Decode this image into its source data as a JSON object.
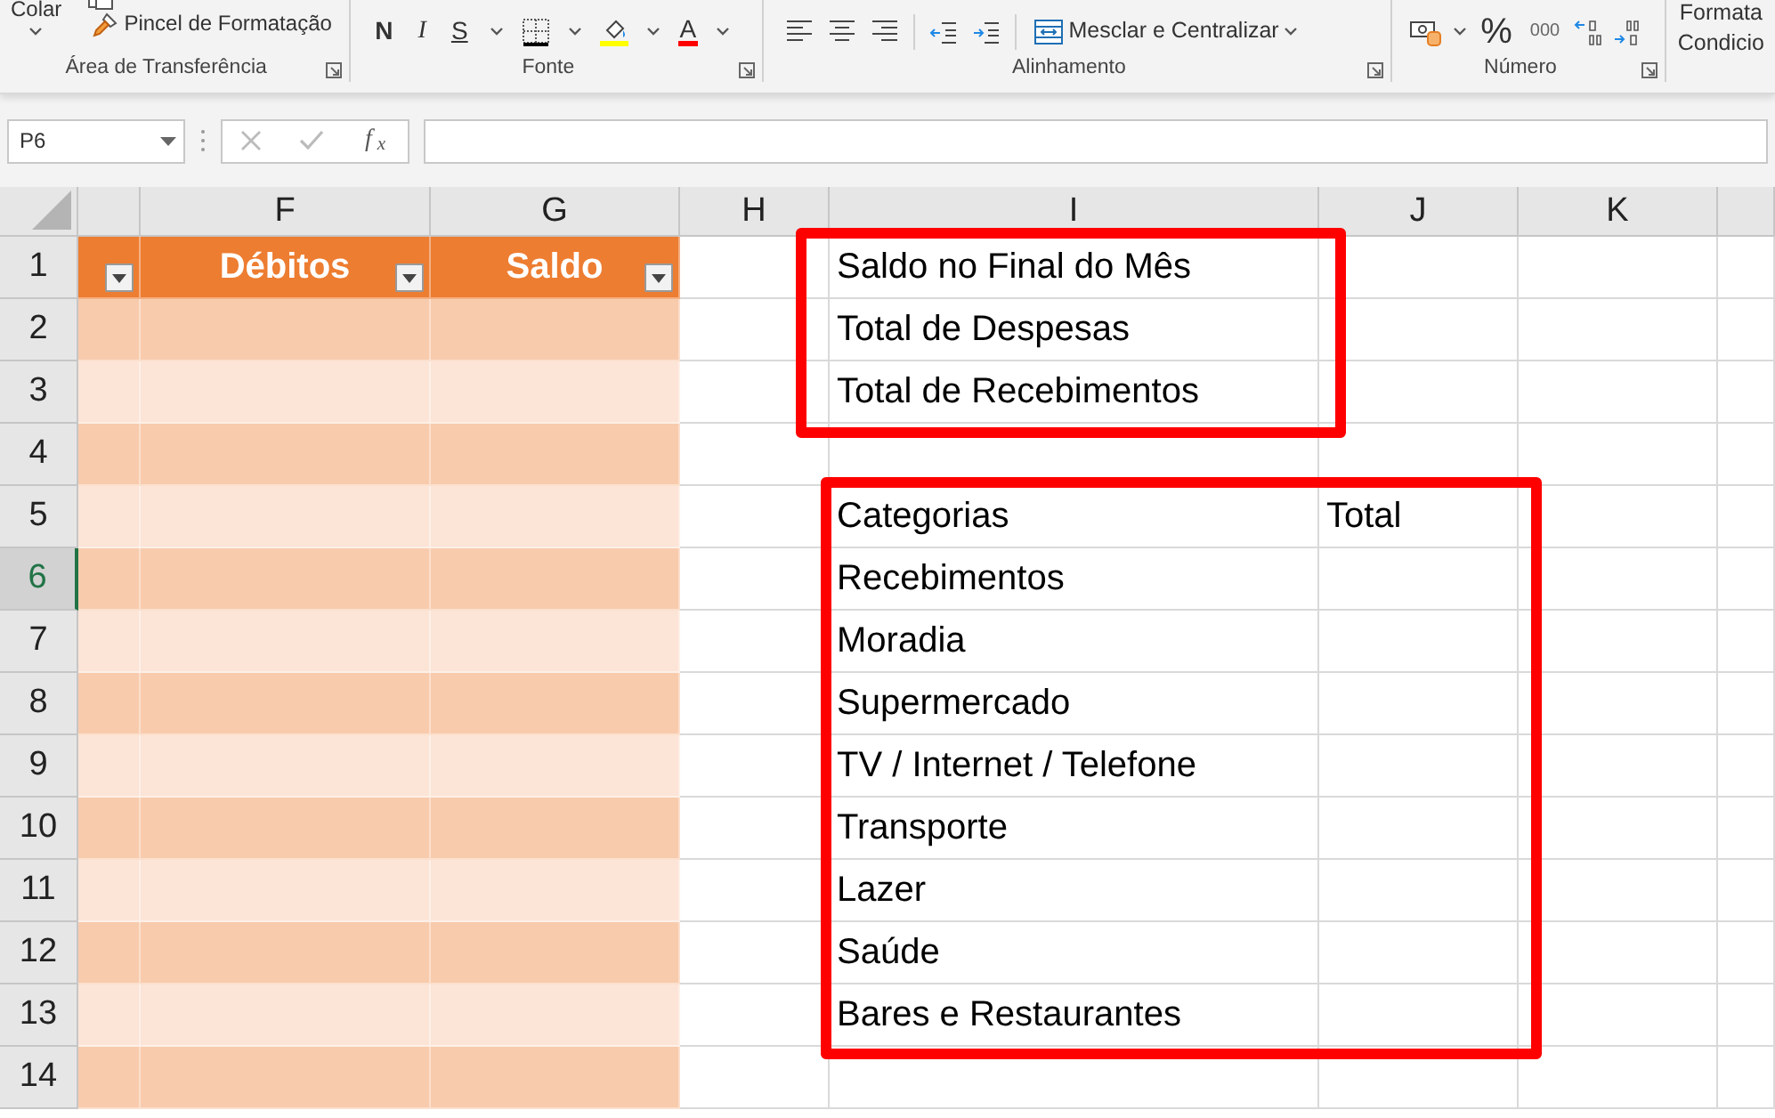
{
  "ribbon": {
    "clipboard": {
      "paste_label": "Colar",
      "format_painter_label": "Pincel de Formatação",
      "label": "Área de Transferência"
    },
    "font": {
      "label": "Fonte",
      "bold_label": "N",
      "italic_label": "I",
      "underline_label": "S",
      "font_color_letter": "A"
    },
    "alignment": {
      "label": "Alinhamento",
      "merge_label": "Mesclar e Centralizar"
    },
    "number": {
      "label": "Número",
      "percent_label": "%",
      "thousands_label": "000"
    },
    "styles": {
      "conditional_formatting_lines": [
        "Formata",
        "Condicio"
      ]
    }
  },
  "formula_bar": {
    "name_box": "P6",
    "function_label": "f$_{x}$"
  },
  "sheet": {
    "columns": [
      "F",
      "G",
      "H",
      "I",
      "J",
      "K"
    ],
    "rows": [
      {
        "label": "1",
        "selected": false
      },
      {
        "label": "2",
        "selected": false
      },
      {
        "label": "3",
        "selected": false
      },
      {
        "label": "4",
        "selected": false
      },
      {
        "label": "5",
        "selected": false
      },
      {
        "label": "6",
        "selected": true
      },
      {
        "label": "7",
        "selected": false
      },
      {
        "label": "8",
        "selected": false
      },
      {
        "label": "9",
        "selected": false
      },
      {
        "label": "10",
        "selected": false
      },
      {
        "label": "11",
        "selected": false
      },
      {
        "label": "12",
        "selected": false
      },
      {
        "label": "13",
        "selected": false
      },
      {
        "label": "14",
        "selected": false
      }
    ],
    "excel_table": {
      "headers": [
        "Débitos",
        "Saldo"
      ]
    },
    "summary": {
      "highlighted": true,
      "items": [
        "Saldo no Final do Mês",
        "Total de Despesas",
        "Total de Recebimentos"
      ]
    },
    "category_table": {
      "highlighted": true,
      "headers": [
        "Categorias",
        "Total"
      ],
      "items": [
        "Recebimentos",
        "Moradia",
        "Supermercado",
        "TV / Internet / Telefone",
        "Transporte",
        "Lazer",
        "Saúde",
        "Bares e Restaurantes"
      ]
    }
  }
}
